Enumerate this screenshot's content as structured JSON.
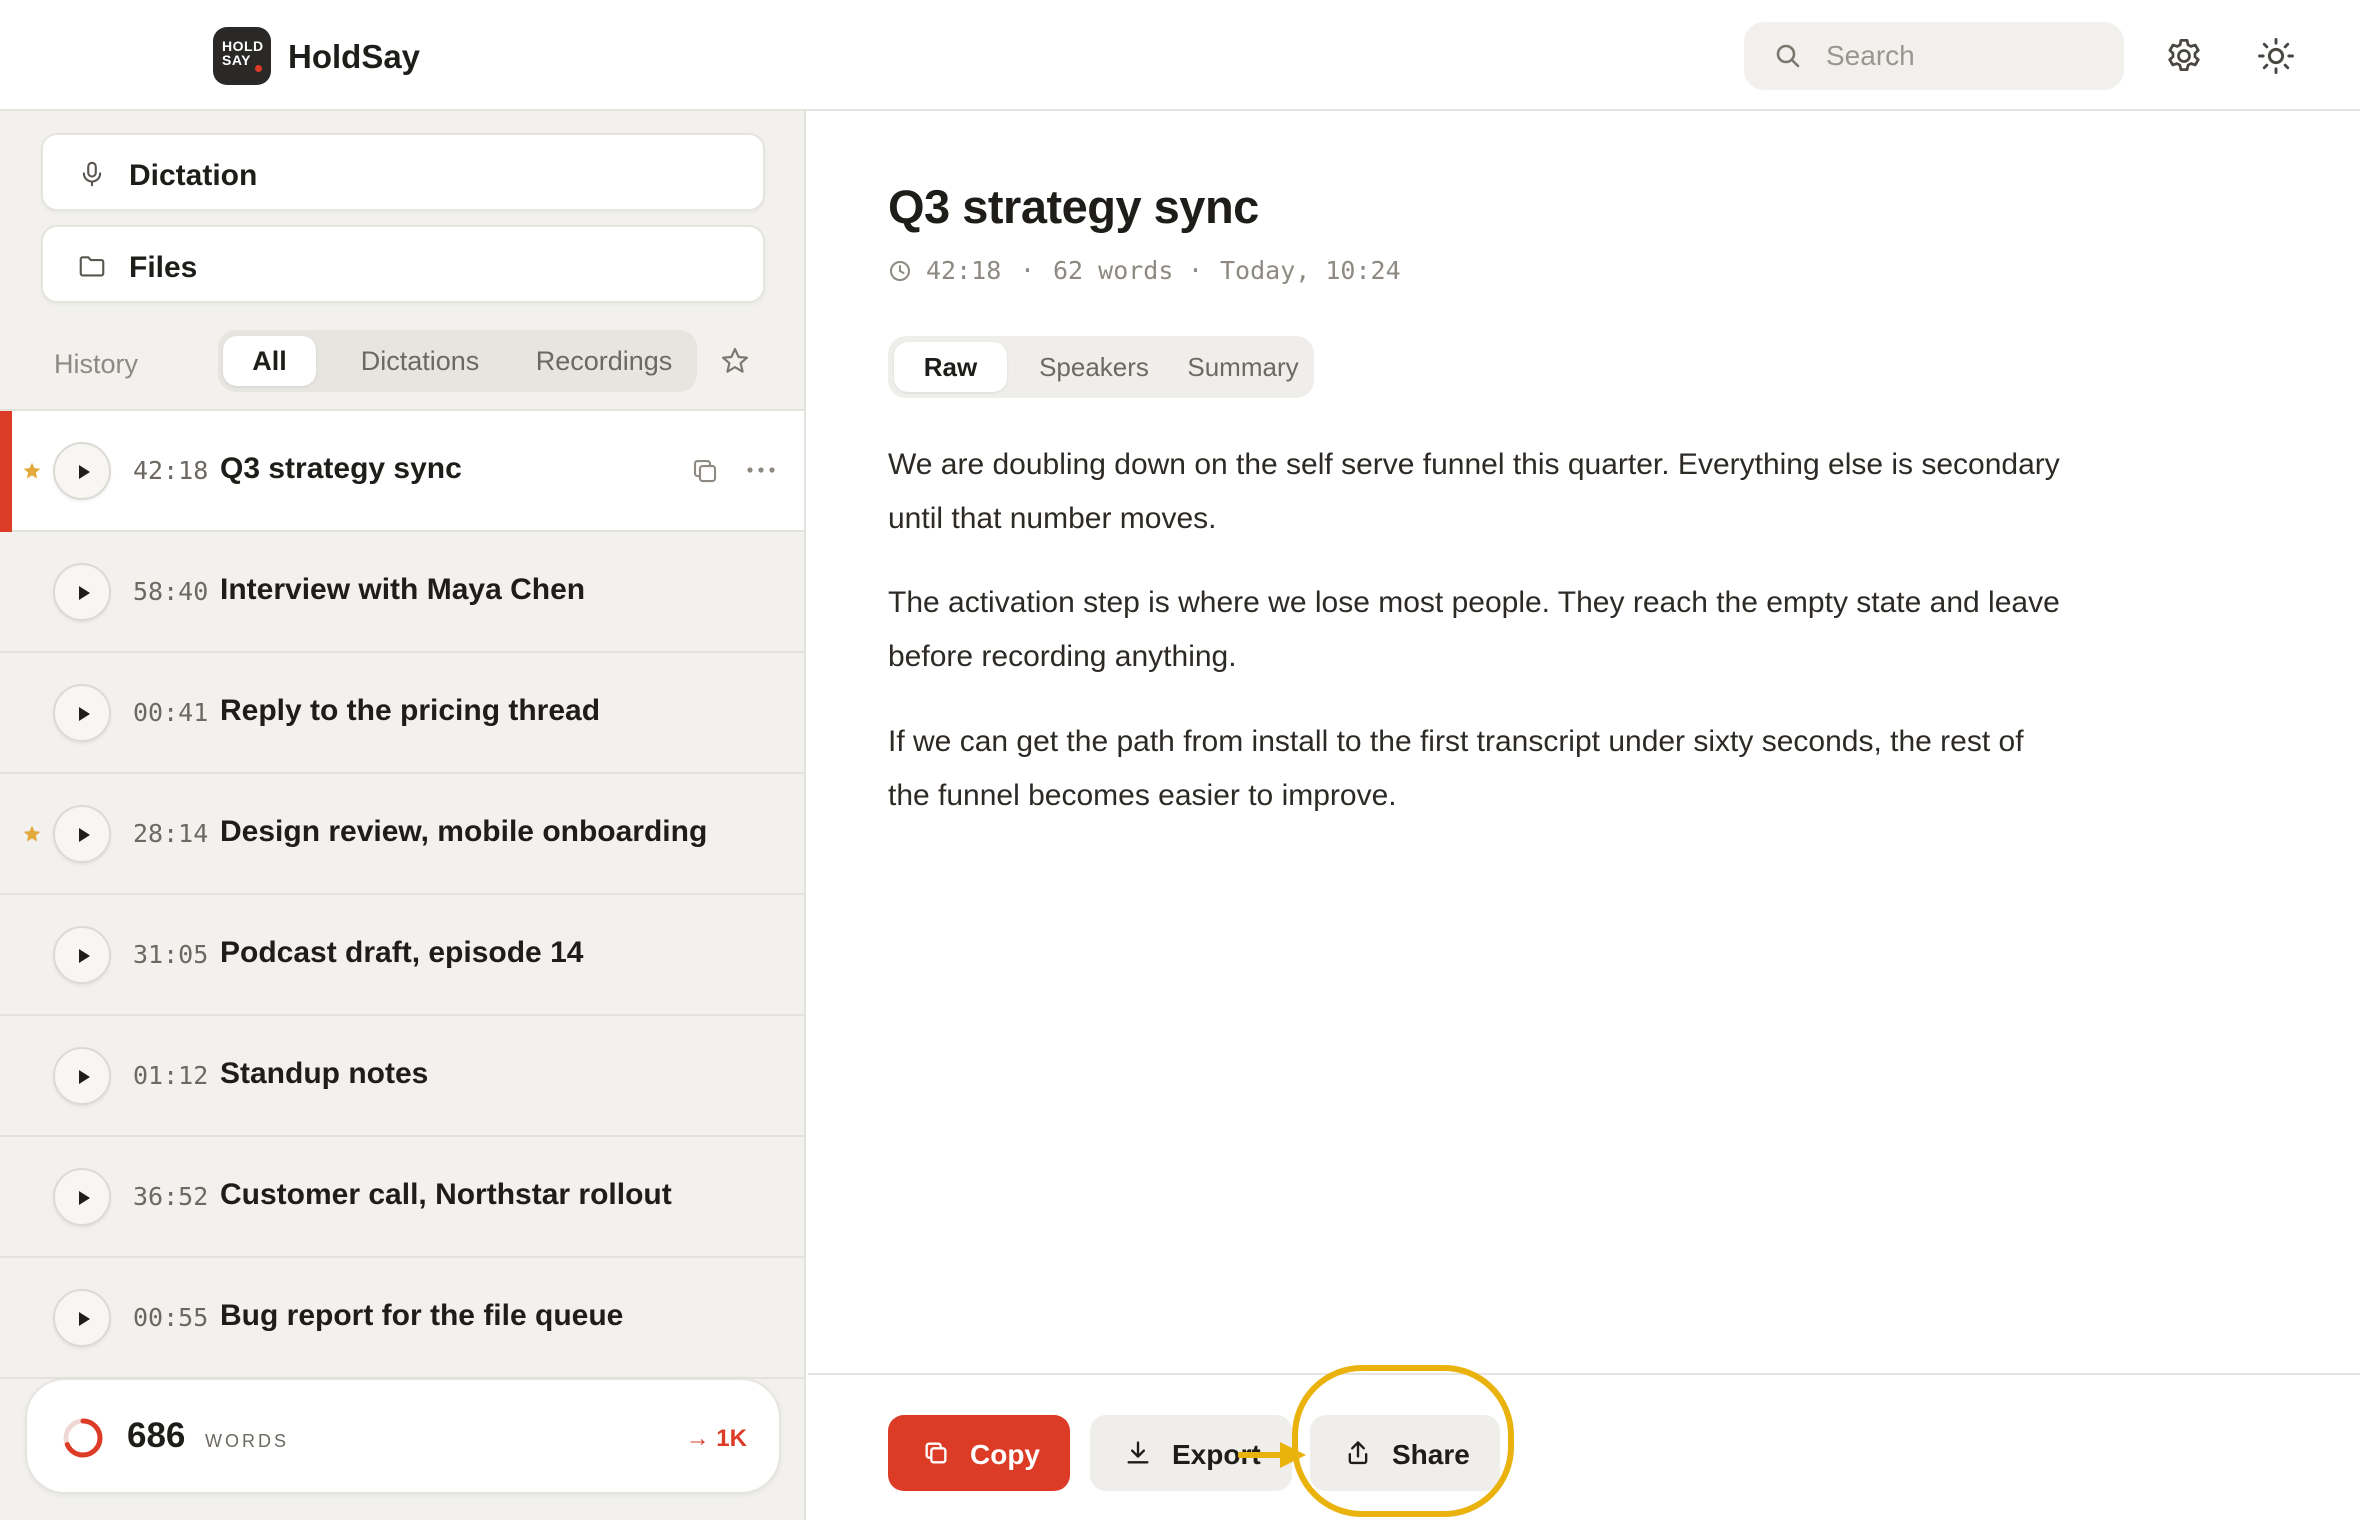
{
  "colors": {
    "accent": "#dc3b26",
    "star": "#e3a93b",
    "highlight": "#eab20c"
  },
  "header": {
    "logo_line1": "HOLD",
    "logo_line2": "SAY",
    "app_name": "HoldSay",
    "search_placeholder": "Search",
    "icons": [
      "search-icon",
      "gear-icon",
      "sun-icon"
    ]
  },
  "sidebar": {
    "nav": [
      {
        "label": "Dictation",
        "icon": "microphone-icon"
      },
      {
        "label": "Files",
        "icon": "folder-icon"
      }
    ],
    "history_label": "History",
    "filters": [
      "All",
      "Dictations",
      "Recordings"
    ],
    "active_filter": "All",
    "items": [
      {
        "duration": "42:18",
        "title": "Q3 strategy sync",
        "starred": true,
        "selected": true
      },
      {
        "duration": "58:40",
        "title": "Interview with Maya Chen",
        "starred": false,
        "selected": false
      },
      {
        "duration": "00:41",
        "title": "Reply to the pricing thread",
        "starred": false,
        "selected": false
      },
      {
        "duration": "28:14",
        "title": "Design review, mobile onboarding",
        "starred": true,
        "selected": false
      },
      {
        "duration": "31:05",
        "title": "Podcast draft, episode 14",
        "starred": false,
        "selected": false
      },
      {
        "duration": "01:12",
        "title": "Standup notes",
        "starred": false,
        "selected": false
      },
      {
        "duration": "36:52",
        "title": "Customer call, Northstar rollout",
        "starred": false,
        "selected": false
      },
      {
        "duration": "00:55",
        "title": "Bug report for the file queue",
        "starred": false,
        "selected": false
      }
    ],
    "word_counter": {
      "count": "686",
      "unit": "WORDS",
      "goal": "→ 1K",
      "progress": 0.686
    }
  },
  "main": {
    "title": "Q3 strategy sync",
    "meta": {
      "duration": "42:18",
      "sep1": "·",
      "words": "62 words",
      "sep2": "·",
      "timestamp": "Today, 10:24"
    },
    "tabs": [
      "Raw",
      "Speakers",
      "Summary"
    ],
    "active_tab": "Raw",
    "paragraphs": [
      "We are doubling down on the self serve funnel this quarter. Everything else is secondary until that number moves.",
      "The activation step is where we lose most people. They reach the empty state and leave before recording anything.",
      "If we can get the path from install to the first transcript under sixty seconds, the rest of the funnel becomes easier to improve."
    ],
    "actions": {
      "copy": "Copy",
      "export": "Export",
      "share": "Share"
    }
  }
}
